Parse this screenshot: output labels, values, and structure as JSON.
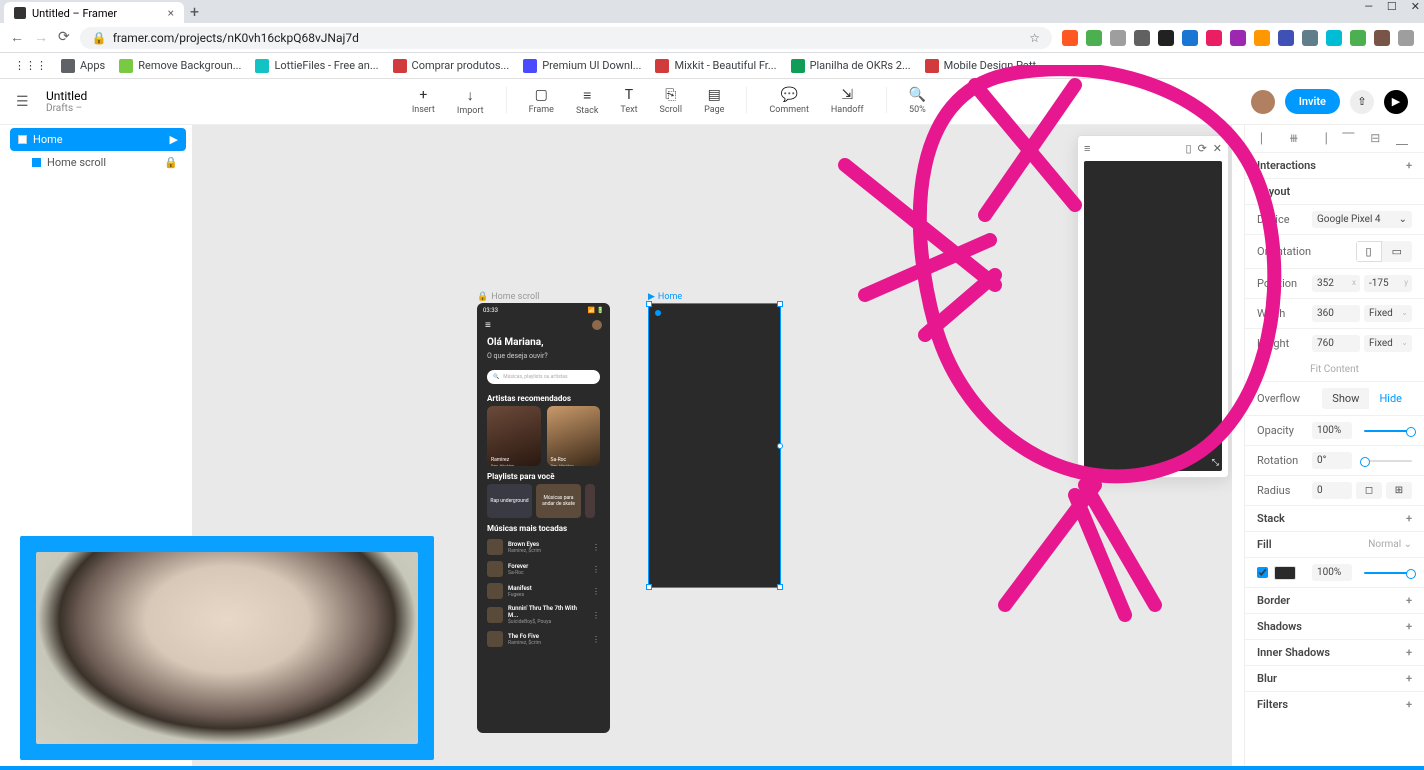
{
  "browser": {
    "tab_title": "Untitled – Framer",
    "url": "framer.com/projects/nK0vh16ckpQ68vJNaj7d",
    "bookmarks": [
      {
        "label": "Apps",
        "color": "#5f6368"
      },
      {
        "label": "Remove Backgroun...",
        "color": "#7ac943"
      },
      {
        "label": "LottieFiles - Free an...",
        "color": "#13c2c2"
      },
      {
        "label": "Comprar produtos...",
        "color": "#d13b3b"
      },
      {
        "label": "Premium UI Downl...",
        "color": "#4a4aff"
      },
      {
        "label": "Mixkit - Beautiful Fr...",
        "color": "#d13b3b"
      },
      {
        "label": "Planilha de OKRs 2...",
        "color": "#0f9d58"
      },
      {
        "label": "Mobile Design Patt...",
        "color": "#d13b3b"
      }
    ],
    "ext_colors": [
      "#ff5722",
      "#4caf50",
      "#9e9e9e",
      "#616161",
      "#212121",
      "#1976d2",
      "#e91e63",
      "#9c27b0",
      "#ff9800",
      "#3f51b5",
      "#607d8b",
      "#00bcd4",
      "#4caf50",
      "#795548",
      "#9e9e9e"
    ]
  },
  "app": {
    "title": "Untitled",
    "subtitle": "Drafts –",
    "tools": [
      {
        "icon": "+",
        "label": "Insert"
      },
      {
        "icon": "↓",
        "label": "Import"
      },
      {
        "icon": "▢",
        "label": "Frame"
      },
      {
        "icon": "≡",
        "label": "Stack"
      },
      {
        "icon": "T",
        "label": "Text"
      },
      {
        "icon": "⎘",
        "label": "Scroll"
      },
      {
        "icon": "▤",
        "label": "Page"
      },
      {
        "icon": "💬",
        "label": "Comment"
      },
      {
        "icon": "⇲",
        "label": "Handoff"
      },
      {
        "icon": "🔍",
        "label": "50%"
      }
    ],
    "invite": "Invite"
  },
  "pages": {
    "active": "Home",
    "child": "Home scroll"
  },
  "canvas": {
    "label_locked": "Home scroll",
    "label_selected": "Home",
    "mock": {
      "time": "03:33",
      "greeting": "Olá Mariana,",
      "sub": "O que deseja ouvir?",
      "search_ph": "Músicas, playlists ou artistas",
      "sec_artists": "Artistas recomendados",
      "artists": [
        {
          "name": "Ramirez",
          "genre": "Rap, Hip-Hop"
        },
        {
          "name": "Sa-Roc",
          "genre": "Rap, Hip-Hop"
        }
      ],
      "sec_playlists": "Playlists para você",
      "playlists": [
        "Rap underground",
        "Músicas para andar de skate"
      ],
      "sec_tracks": "Músicas mais tocadas",
      "tracks": [
        {
          "name": "Brown Eyes",
          "artist": "Ramirez, $crim"
        },
        {
          "name": "Forever",
          "artist": "Sa-Roc"
        },
        {
          "name": "Manifest",
          "artist": "Fugees"
        },
        {
          "name": "Runnin' Thru The 7th With M...",
          "artist": "$uicideBoy$, Pouya"
        },
        {
          "name": "The Fo Five",
          "artist": "Ramirez, $crim"
        }
      ]
    }
  },
  "inspector": {
    "interactions": "Interactions",
    "layout": "Layout",
    "device_lbl": "Device",
    "device_val": "Google Pixel 4",
    "orient_lbl": "Orientation",
    "pos_lbl": "Position",
    "pos_x": "352",
    "pos_y": "-175",
    "width_lbl": "Width",
    "width_v": "360",
    "width_m": "Fixed",
    "height_lbl": "Height",
    "height_v": "760",
    "height_m": "Fixed",
    "fit": "Fit Content",
    "overflow_lbl": "Overflow",
    "overflow_show": "Show",
    "overflow_hide": "Hide",
    "opacity_lbl": "Opacity",
    "opacity_v": "100%",
    "rotation_lbl": "Rotation",
    "rotation_v": "0°",
    "radius_lbl": "Radius",
    "radius_v": "0",
    "stack": "Stack",
    "fill": "Fill",
    "fill_mode": "Normal",
    "fill_pct": "100%",
    "border": "Border",
    "shadows": "Shadows",
    "inner": "Inner Shadows",
    "blur": "Blur",
    "filters": "Filters"
  }
}
